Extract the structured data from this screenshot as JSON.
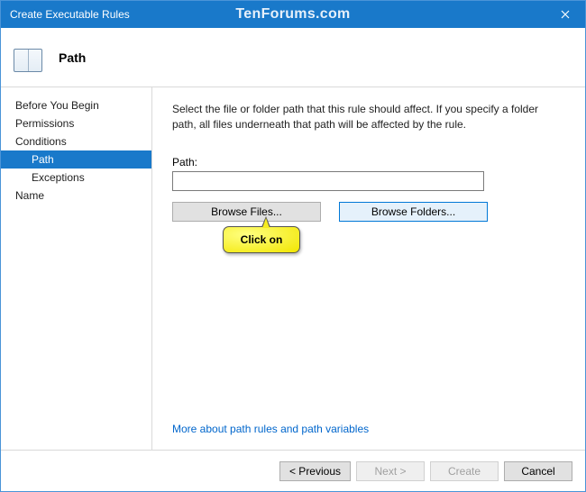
{
  "titlebar": {
    "title": "Create Executable Rules",
    "watermark": "TenForums.com"
  },
  "header": {
    "title": "Path"
  },
  "sidebar": {
    "items": [
      {
        "label": "Before You Begin",
        "sub": false,
        "selected": false
      },
      {
        "label": "Permissions",
        "sub": false,
        "selected": false
      },
      {
        "label": "Conditions",
        "sub": false,
        "selected": false
      },
      {
        "label": "Path",
        "sub": true,
        "selected": true
      },
      {
        "label": "Exceptions",
        "sub": true,
        "selected": false
      },
      {
        "label": "Name",
        "sub": false,
        "selected": false
      }
    ]
  },
  "content": {
    "description": "Select the file or folder path that this rule should affect. If you specify a folder path, all files underneath that path will be affected by the rule.",
    "path_label": "Path:",
    "path_value": "",
    "browse_files": "Browse Files...",
    "browse_folders": "Browse Folders...",
    "more_link": "More about path rules and path variables"
  },
  "callout": {
    "text": "Click on"
  },
  "footer": {
    "previous": "< Previous",
    "next": "Next >",
    "create": "Create",
    "cancel": "Cancel"
  }
}
